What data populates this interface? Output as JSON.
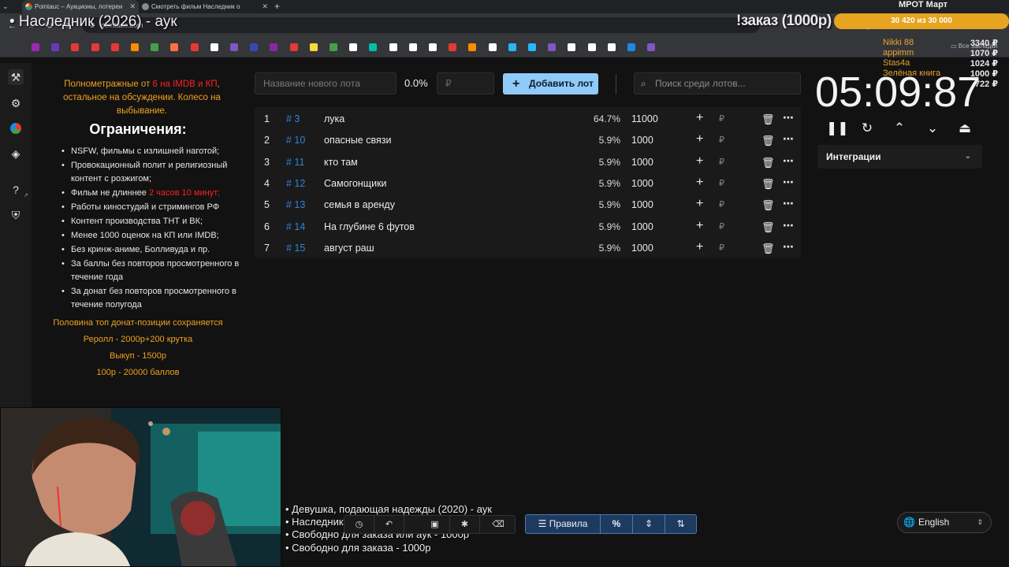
{
  "browser": {
    "tabs": [
      {
        "label": "Pointauc – Аукционы, лотереи"
      },
      {
        "label": "Смотреть фильм Наследник о"
      }
    ],
    "url": "pointauc.com",
    "bookmarks_label": "Все закладки"
  },
  "overlay": {
    "title": "• Наследник (2026) - аук",
    "order_label": "!заказ (1000р)",
    "mrot_label": "МРОТ Март",
    "goal_text": "30 420  из 30 000",
    "goal_progress": 1.0,
    "donors": [
      {
        "name": "Nikki 88",
        "amount": "3340 ₽"
      },
      {
        "name": "appimm",
        "amount": "1070 ₽"
      },
      {
        "name": "Stas4a",
        "amount": "1024 ₽"
      },
      {
        "name": "Зелёная книга",
        "amount": "1000 ₽"
      },
      {
        "name": "",
        "amount": "722 ₽"
      }
    ]
  },
  "rules": {
    "top_line_1": "Полнометражные от ",
    "top_red_1": "6 на IMDB и КП",
    "top_line_2": ", остальное на обсуждении. Колесо на выбывание.",
    "heading": "Ограничения:",
    "items": [
      "NSFW, фильмы с излишней наготой;",
      "Провокационный полит и религиозный контент с розжигом;",
      "Фильм не длиннее ",
      "Работы киностудий и стримингов РФ",
      "Контент производства ТНТ и ВК;",
      "Менее 1000 оценок на КП или IMDB;",
      "Без кринж-аниме, Болливуда и пр.",
      "За баллы без повторов просмотренного в течение года",
      "За донат без повторов просмотренного в течение полугода"
    ],
    "item3_red": "2 часов 10 минут;",
    "footer": [
      "Половина топ донат-позиции сохраняется",
      "Реролл - 2000р+200 крутка",
      "Выкуп - 1500р",
      "100р - 20000 баллов"
    ]
  },
  "toolbar": {
    "lot_placeholder": "Название нового лота",
    "percent": "0.0%",
    "rub_placeholder": "₽",
    "add_label": "Добавить лот",
    "search_placeholder": "Поиск среди лотов..."
  },
  "lots": [
    {
      "num": "1",
      "id": "# 3",
      "name": "лука",
      "pct": "64.7%",
      "amount": "11000"
    },
    {
      "num": "2",
      "id": "# 10",
      "name": "опасные связи",
      "pct": "5.9%",
      "amount": "1000"
    },
    {
      "num": "3",
      "id": "# 11",
      "name": "кто там",
      "pct": "5.9%",
      "amount": "1000"
    },
    {
      "num": "4",
      "id": "# 12",
      "name": "Самогонщики",
      "pct": "5.9%",
      "amount": "1000"
    },
    {
      "num": "5",
      "id": "# 13",
      "name": "семья в аренду",
      "pct": "5.9%",
      "amount": "1000"
    },
    {
      "num": "6",
      "id": "# 14",
      "name": "На глубине 6 футов",
      "pct": "5.9%",
      "amount": "1000"
    },
    {
      "num": "7",
      "id": "# 15",
      "name": "август раш",
      "pct": "5.9%",
      "amount": "1000"
    }
  ],
  "row_currency": "₽",
  "timer": {
    "display": "05:09:87",
    "integrations_label": "Интеграции"
  },
  "bottom_list": [
    "• Девушка, подающая надежды (2020) - аук",
    "• Наследник (2026) - аук",
    "• Свободно для заказа или аук - 1000р",
    "• Свободно для заказа - 1000р"
  ],
  "bottom_toolbar": {
    "rules_label": "Правила"
  },
  "language": {
    "selected": "English"
  },
  "colors": {
    "accent": "#90caf9",
    "lot_id": "#2e86d6",
    "rules_orange": "#f0a020",
    "rules_red": "#ff2020",
    "donor_orange": "#e6a22a"
  }
}
